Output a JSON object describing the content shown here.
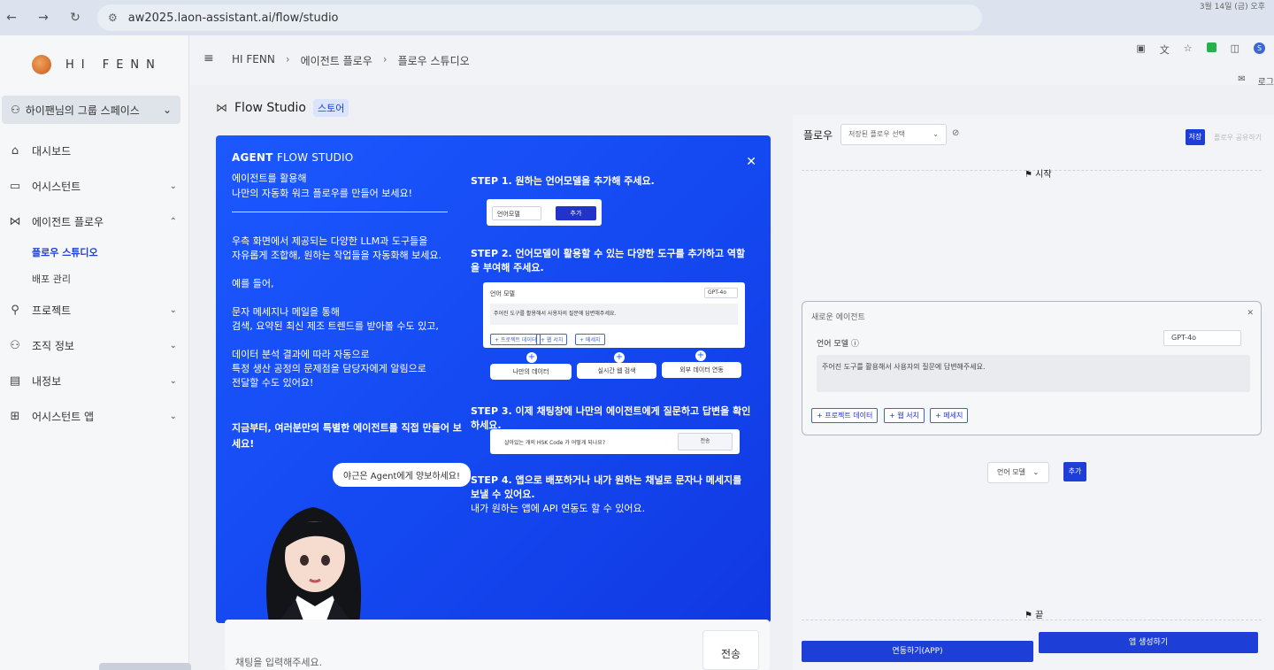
{
  "browser": {
    "url": "aw2025.laon-assistant.ai/flow/studio",
    "top_right_text": "3월 14일 (금) 오후"
  },
  "brand": {
    "name": "HI FENN"
  },
  "sidebar": {
    "workspace": "하이팬님의 그룹 스페이스",
    "items": [
      {
        "label": "대시보드"
      },
      {
        "label": "어시스턴트"
      },
      {
        "label": "에이전트 플로우"
      },
      {
        "label": "프로젝트"
      },
      {
        "label": "조직 정보"
      },
      {
        "label": "내정보"
      },
      {
        "label": "어시스턴트 앱"
      }
    ],
    "sub_items": [
      {
        "label": "플로우 스튜디오",
        "active": true
      },
      {
        "label": "배포 관리",
        "active": false
      }
    ]
  },
  "topbar": {
    "breadcrumb": [
      "HI FENN",
      "에이전트 플로우",
      "플로우 스튜디오"
    ],
    "login_label": "로그"
  },
  "page": {
    "title": "Flow Studio",
    "badge": "스토어"
  },
  "intro": {
    "title_bold": "AGENT",
    "title_rest": "FLOW STUDIO",
    "lead_line1": "에이전트를 활용해",
    "lead_line2": "나만의 자동화 워크 플로우를 만들어 보세요!",
    "body1": "우측 화면에서 제공되는 다양한 LLM과 도구들을\n자유롭게 조합해, 원하는 작업들을 자동화해 보세요.",
    "body2": "예를 들어,",
    "body3": "문자 메세지나 메일을 통해\n검색, 요약된 최신 제조 트렌드를 받아볼 수도 있고,",
    "body4": "데이터 분석 결과에 따라 자동으로\n특정 생산 공정의 문제점을 담당자에게 알림으로\n전달할 수도 있어요!",
    "cta": "지금부터, 여러분만의 특별한 에이전트를 직접 만들어 보세요!",
    "bubble": "야근은 Agent에게 양보하세요!",
    "step1_title": "STEP 1. 원하는 언어모델을 추가해 주세요.",
    "step2_title": "STEP 2. 언어모델이 활용할 수 있는 다양한 도구를 추가하고 역할을 부여해 주세요.",
    "step3_title": "STEP 3. 이제 채팅창에 나만의 에이전트에게 질문하고 답변을 확인하세요.",
    "step4_title": "STEP 4. 앱으로 배포하거나 내가 원하는 채널로 문자나 메세지를 보낼 수 있어요.",
    "step4_desc": "내가 원하는 앱에 API 연동도 할 수 있어요.",
    "mock1_select": "언어모델",
    "mock1_add": "추가",
    "mock2_label": "언어 모델",
    "mock2_model": "GPT-4o",
    "mock2_prompt": "주어진 도구를 활용해서 사용자의 질문에 답변해주세요.",
    "mock2_tags": [
      "+ 프로젝트 데이터",
      "+ 웹 서치",
      "+ 메세지"
    ],
    "mock2_pills": [
      "나만의 데이터",
      "실시간 웹 검색",
      "외부 데이터 연동"
    ],
    "mock3_question": "살아있는 개의 HSK Code 가 어떻게 되나요?",
    "mock3_send": "전송"
  },
  "chat": {
    "placeholder": "채팅을 입력해주세요.",
    "send": "전송"
  },
  "flow": {
    "label": "플로우",
    "select_placeholder": "저장된 플로우 선택",
    "save": "저장",
    "share": "플로우 공유하기",
    "start": "시작",
    "end": "끝",
    "agent": {
      "title": "새로운 에이전트",
      "lm_label": "언어 모델",
      "model": "GPT-4o",
      "prompt": "주어진 도구를 활용해서 사용자의 질문에 답변해주세요.",
      "tags": [
        "+ 프로젝트 데이터",
        "+ 웹 서치",
        "+ 메세지"
      ]
    },
    "lm_select": "언어 모델",
    "add": "추가",
    "connect_app": "연동하기(APP)",
    "create_app": "앱 생성하기"
  }
}
